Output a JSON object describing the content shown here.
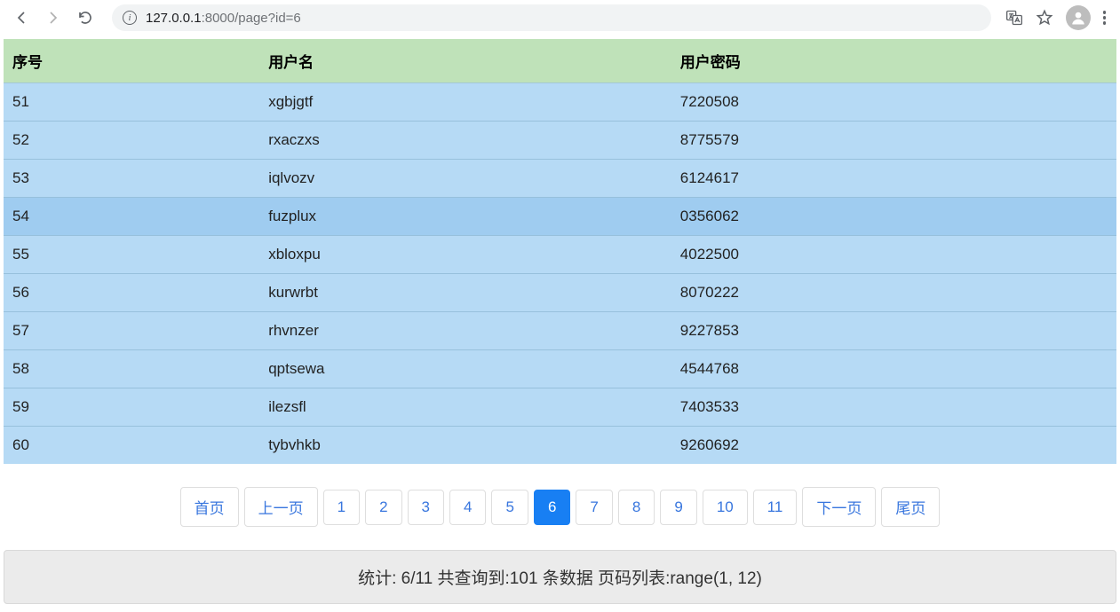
{
  "browser": {
    "url_host": "127.0.0.1",
    "url_port": ":8000",
    "url_path": "/page?id=6"
  },
  "table": {
    "headers": {
      "id": "序号",
      "user": "用户名",
      "pass": "用户密码"
    },
    "rows": [
      {
        "id": "51",
        "user": "xgbjgtf",
        "pass": "7220508"
      },
      {
        "id": "52",
        "user": "rxaczxs",
        "pass": "8775579"
      },
      {
        "id": "53",
        "user": "iqlvozv",
        "pass": "6124617"
      },
      {
        "id": "54",
        "user": "fuzplux",
        "pass": "0356062"
      },
      {
        "id": "55",
        "user": "xbloxpu",
        "pass": "4022500"
      },
      {
        "id": "56",
        "user": "kurwrbt",
        "pass": "8070222"
      },
      {
        "id": "57",
        "user": "rhvnzer",
        "pass": "9227853"
      },
      {
        "id": "58",
        "user": "qptsewa",
        "pass": "4544768"
      },
      {
        "id": "59",
        "user": "ilezsfl",
        "pass": "7403533"
      },
      {
        "id": "60",
        "user": "tybvhkb",
        "pass": "9260692"
      }
    ],
    "highlighted_row_index": 3
  },
  "pagination": {
    "first": "首页",
    "prev": "上一页",
    "next": "下一页",
    "last": "尾页",
    "pages": [
      "1",
      "2",
      "3",
      "4",
      "5",
      "6",
      "7",
      "8",
      "9",
      "10",
      "11"
    ],
    "active": "6"
  },
  "stats": "统计: 6/11 共查询到:101 条数据 页码列表:range(1, 12)"
}
